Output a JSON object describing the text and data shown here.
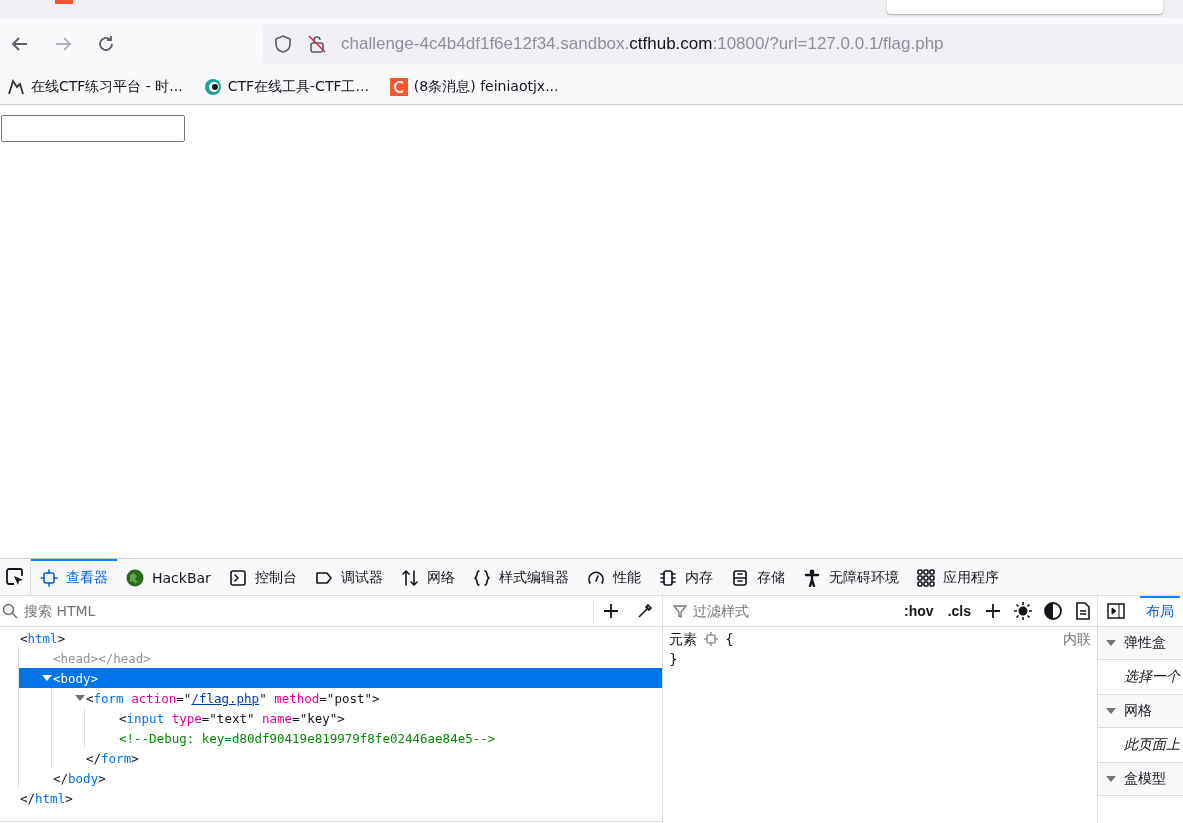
{
  "toolbar": {
    "url": {
      "prefix": "challenge-4c4b4df1f6e12f34.sandbox.",
      "domain": "ctfhub.com",
      "suffix": ":10800/?url=127.0.0.1/flag.php"
    }
  },
  "bookmarks": [
    {
      "label": "在线CTF练习平台 - 时..."
    },
    {
      "label": "CTF在线工具-CTF工..."
    },
    {
      "label": "(8条消息) feiniaotjx..."
    }
  ],
  "devtools": {
    "tabs": [
      {
        "label": "查看器",
        "selected": true
      },
      {
        "label": "HackBar",
        "selected": false
      },
      {
        "label": "控制台",
        "selected": false
      },
      {
        "label": "调试器",
        "selected": false
      },
      {
        "label": "网络",
        "selected": false
      },
      {
        "label": "样式编辑器",
        "selected": false
      },
      {
        "label": "性能",
        "selected": false
      },
      {
        "label": "内存",
        "selected": false
      },
      {
        "label": "存储",
        "selected": false
      },
      {
        "label": "无障碍环境",
        "selected": false
      },
      {
        "label": "应用程序",
        "selected": false
      }
    ],
    "search": {
      "placeholder": "搜索 HTML"
    },
    "markup": [
      {
        "selected": false,
        "parts": [
          {
            "kind": "punct",
            "text": "<"
          },
          {
            "kind": "tag",
            "text": "html"
          },
          {
            "kind": "punct",
            "text": ">"
          }
        ],
        "children": [
          {
            "selected": false,
            "parts": [
              {
                "kind": "muted",
                "text": "<head></head>"
              }
            ]
          },
          {
            "selected": true,
            "expanded": true,
            "parts": [
              {
                "kind": "punct",
                "text": "<"
              },
              {
                "kind": "tag",
                "text": "body"
              },
              {
                "kind": "punct",
                "text": ">"
              }
            ],
            "children": [
              {
                "selected": false,
                "expanded": true,
                "parts": [
                  {
                    "kind": "punct",
                    "text": "<"
                  },
                  {
                    "kind": "tag",
                    "text": "form"
                  },
                  {
                    "kind": "attr",
                    "text": " action"
                  },
                  {
                    "kind": "punct",
                    "text": "=\""
                  },
                  {
                    "kind": "link",
                    "text": "/flag.php"
                  },
                  {
                    "kind": "punct",
                    "text": "\""
                  },
                  {
                    "kind": "attr",
                    "text": " method"
                  },
                  {
                    "kind": "punct",
                    "text": "=\"post\">"
                  }
                ],
                "children": [
                  {
                    "selected": false,
                    "parts": [
                      {
                        "kind": "punct",
                        "text": "<"
                      },
                      {
                        "kind": "tag",
                        "text": "input"
                      },
                      {
                        "kind": "attr",
                        "text": " type"
                      },
                      {
                        "kind": "punct",
                        "text": "=\"text\""
                      },
                      {
                        "kind": "attr",
                        "text": " name"
                      },
                      {
                        "kind": "punct",
                        "text": "=\"key\">"
                      }
                    ]
                  },
                  {
                    "selected": false,
                    "parts": [
                      {
                        "kind": "comment",
                        "text": "<!--Debug: key=d80df90419e819979f8fe02446ae84e5-->"
                      }
                    ]
                  }
                ],
                "closing": [
                  {
                    "kind": "punct",
                    "text": "</"
                  },
                  {
                    "kind": "tag",
                    "text": "form"
                  },
                  {
                    "kind": "punct",
                    "text": ">"
                  }
                ]
              }
            ],
            "closing": [
              {
                "kind": "punct",
                "text": "</"
              },
              {
                "kind": "tag",
                "text": "body"
              },
              {
                "kind": "punct",
                "text": ">"
              }
            ]
          }
        ],
        "closing": [
          {
            "kind": "punct",
            "text": "</"
          },
          {
            "kind": "tag",
            "text": "html"
          },
          {
            "kind": "punct",
            "text": ">"
          }
        ]
      }
    ],
    "rules": {
      "filter_placeholder": "过滤样式",
      "hov": ":hov",
      "cls": ".cls",
      "selector": "元素",
      "open_brace": "{",
      "close_brace": "}",
      "source": "内联"
    },
    "sidebar": {
      "tab": {
        "label": "布局",
        "selected": true
      },
      "sections": [
        {
          "title": "弹性盒",
          "expanded": true,
          "body": "选择一个"
        },
        {
          "title": "网格",
          "expanded": true,
          "body": "此页面上"
        },
        {
          "title": "盒模型",
          "expanded": true
        }
      ]
    }
  }
}
